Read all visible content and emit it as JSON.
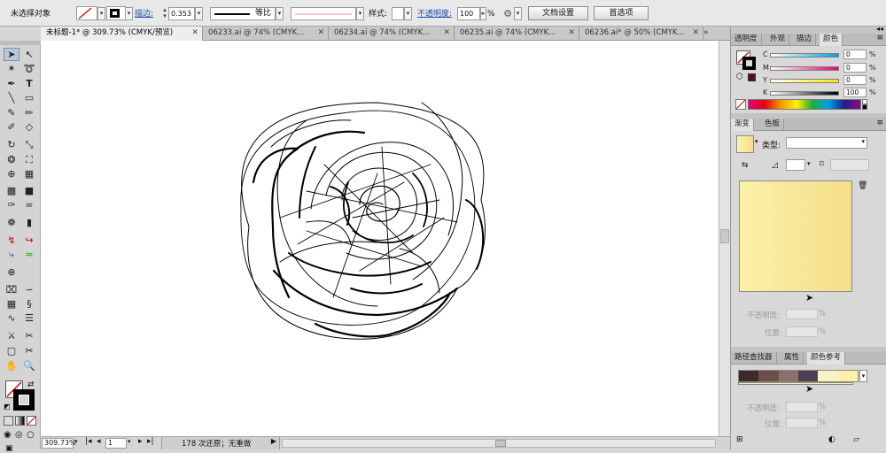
{
  "control_bar": {
    "selection_label": "未选择对象",
    "stroke_label": "描边:",
    "stroke_weight": "0.353",
    "stroke_profile": "等比",
    "style_label": "样式:",
    "opacity_label": "不透明度:",
    "opacity_value": "100",
    "opacity_unit": "%",
    "doc_setup_button": "文档设置",
    "preferences_button": "首选项"
  },
  "tabs": [
    {
      "label": "未标题-1* @ 309.73% (CMYK/预览)",
      "active": true
    },
    {
      "label": "06233.ai @ 74% (CMYK...",
      "active": false
    },
    {
      "label": "06234.ai @ 74% (CMYK...",
      "active": false
    },
    {
      "label": "06235.ai @ 74% (CMYK...",
      "active": false
    },
    {
      "label": "06236.ai* @ 50% (CMYK...",
      "active": false
    }
  ],
  "status": {
    "zoom": "309.73%",
    "page": "1",
    "history": "178 次还原；无重做"
  },
  "color_panel": {
    "tabs": [
      "透明度",
      "外观",
      "描边",
      "颜色"
    ],
    "channels": [
      {
        "label": "C",
        "value": "0",
        "unit": "%"
      },
      {
        "label": "M",
        "value": "0",
        "unit": "%"
      },
      {
        "label": "Y",
        "value": "0",
        "unit": "%"
      },
      {
        "label": "K",
        "value": "100",
        "unit": "%"
      }
    ]
  },
  "gradient_panel": {
    "tabs": [
      "渐变",
      "色板"
    ],
    "type_label": "类型:",
    "opacity_label": "不透明度:",
    "position_label": "位置:",
    "unit": "%",
    "colors": {
      "start": "#fbf1a8",
      "end": "#f5de8a"
    }
  },
  "bottom_panel": {
    "tabs": [
      "路径查找器",
      "属性",
      "颜色参考"
    ],
    "opacity_label": "不透明度:",
    "position_label": "位置:",
    "unit": "%"
  }
}
